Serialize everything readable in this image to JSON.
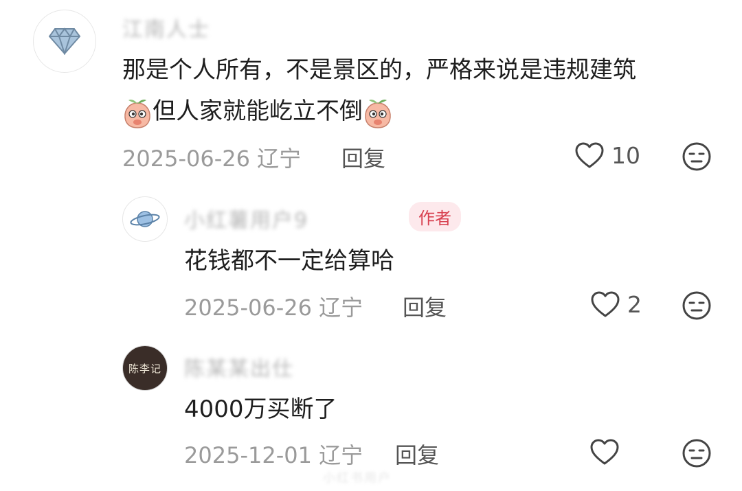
{
  "comments": [
    {
      "username": "江南人士",
      "content_line1": "那是个人所有，不是景区的，严格来说是违规建筑",
      "content_line2": "但人家就能屹立不倒",
      "date": "2025-06-26",
      "location": "辽宁",
      "reply_label": "回复",
      "like_count": "10",
      "avatar_icon": "diamond-icon",
      "emoji_icon": "peach-emoji-icon"
    },
    {
      "username": "小红薯用户9",
      "author_badge": "作者",
      "content": "花钱都不一定给算哈",
      "date": "2025-06-26",
      "location": "辽宁",
      "reply_label": "回复",
      "like_count": "2",
      "avatar_icon": "planet-icon"
    },
    {
      "username": "陈某某出仕",
      "content": "4000万买断了",
      "date": "2025-12-01",
      "location": "辽宁",
      "reply_label": "回复",
      "like_count": "",
      "avatar_text": "陈李记"
    }
  ],
  "watermark": "小红书用户"
}
